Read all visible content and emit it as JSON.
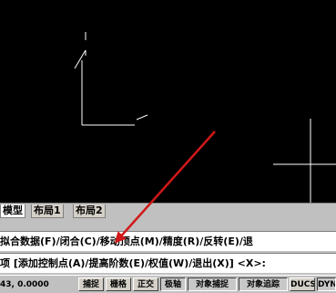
{
  "tabs": {
    "model": "模型",
    "layout1": "布局1",
    "layout2": "布局2"
  },
  "command": {
    "line1": "拟合数据(F)/闭合(C)/移动顶点(M)/精度(R)/反转(E)/退",
    "line2": "项 [添加控制点(A)/提高阶数(E)/权值(W)/退出(X)] <X>:"
  },
  "status": {
    "coords": "43, 0.0000",
    "buttons": [
      "捕捉",
      "栅格",
      "正交",
      "极轴",
      "对象捕捉",
      "对象追踪",
      "DUCS",
      "DYN"
    ]
  },
  "colors": {
    "viewport_bg": "#000000",
    "drawing": "#ffffff",
    "arrow": "#d01818"
  }
}
